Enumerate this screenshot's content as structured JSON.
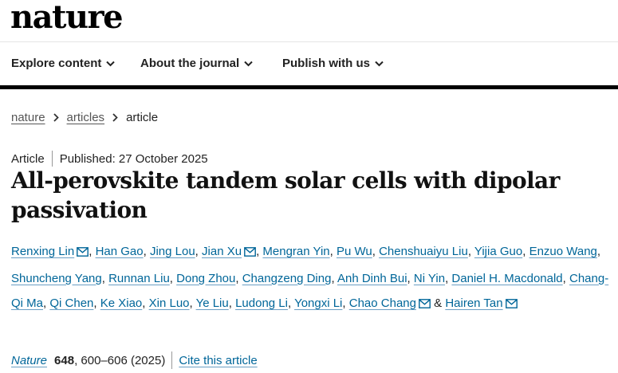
{
  "header": {
    "logo": "nature"
  },
  "nav": {
    "items": [
      {
        "label": "Explore content"
      },
      {
        "label": "About the journal"
      },
      {
        "label": "Publish with us"
      }
    ]
  },
  "breadcrumb": {
    "items": [
      "nature",
      "articles",
      "article"
    ]
  },
  "article": {
    "type": "Article",
    "published": "Published: 27 October 2025",
    "title": "All-perovskite tandem solar cells with dipolar passivation",
    "authors": [
      {
        "name": "Renxing Lin",
        "email": true
      },
      {
        "name": "Han Gao",
        "email": false
      },
      {
        "name": "Jing Lou",
        "email": false
      },
      {
        "name": "Jian Xu",
        "email": true
      },
      {
        "name": "Mengran Yin",
        "email": false
      },
      {
        "name": "Pu Wu",
        "email": false
      },
      {
        "name": "Chenshuaiyu Liu",
        "email": false
      },
      {
        "name": "Yijia Guo",
        "email": false
      },
      {
        "name": "Enzuo Wang",
        "email": false
      },
      {
        "name": "Shuncheng Yang",
        "email": false
      },
      {
        "name": "Runnan Liu",
        "email": false
      },
      {
        "name": "Dong Zhou",
        "email": false
      },
      {
        "name": "Changzeng Ding",
        "email": false
      },
      {
        "name": "Anh Dinh Bui",
        "email": false
      },
      {
        "name": "Ni Yin",
        "email": false
      },
      {
        "name": "Daniel H. Macdonald",
        "email": false
      },
      {
        "name": "Chang-Qi Ma",
        "email": false
      },
      {
        "name": "Qi Chen",
        "email": false
      },
      {
        "name": "Ke Xiao",
        "email": false
      },
      {
        "name": "Xin Luo",
        "email": false
      },
      {
        "name": "Ye Liu",
        "email": false
      },
      {
        "name": "Ludong Li",
        "email": false
      },
      {
        "name": "Yongxi Li",
        "email": false
      },
      {
        "name": "Chao Chang",
        "email": true
      },
      {
        "name": "Hairen Tan",
        "email": true
      }
    ],
    "citation": {
      "journal": "Nature",
      "volume": "648",
      "pages": ", 600–606 (2025)",
      "cite_label": "Cite this article"
    }
  },
  "colors": {
    "link": "#006699",
    "text": "#222222",
    "rule": "#000000"
  },
  "icons": {
    "nav_chevron": "chevron-down-icon",
    "breadcrumb_separator": "chevron-right-icon",
    "email": "mail-icon"
  }
}
